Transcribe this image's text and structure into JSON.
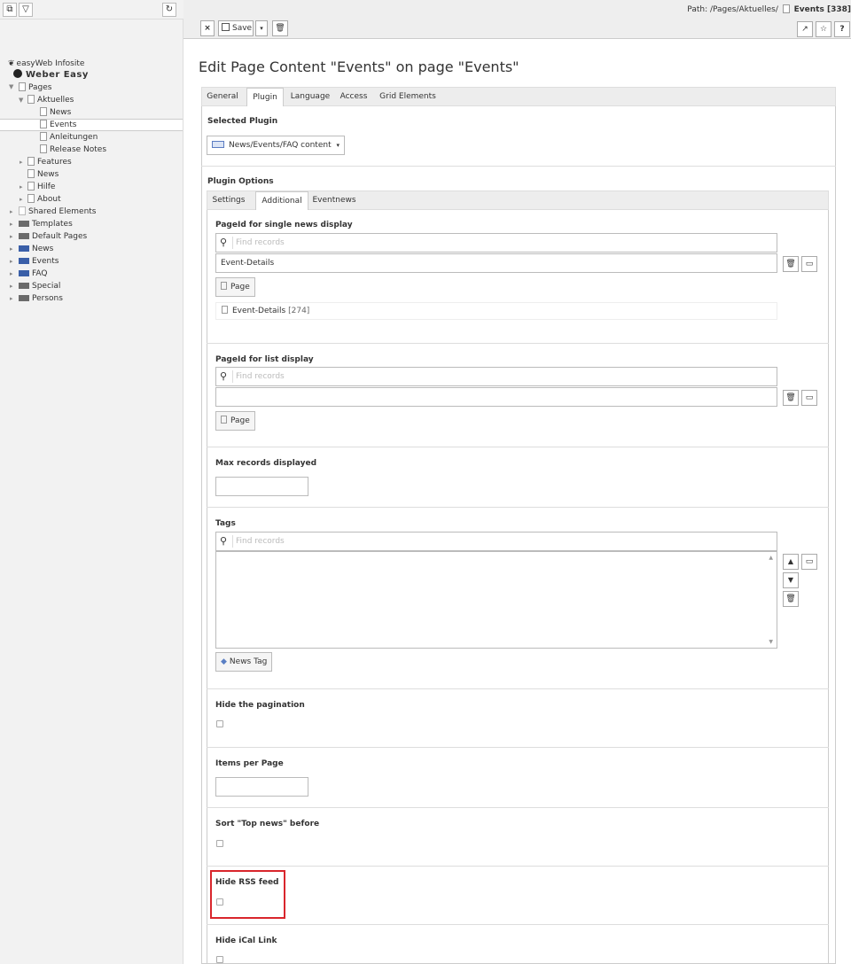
{
  "tree": {
    "toolbar": {
      "new_page_icon": "new-page-icon",
      "filter_icon": "filter-icon",
      "refresh_icon": "refresh-icon"
    },
    "site_name": "easyWeb Infosite",
    "root_title": "Weber Easy",
    "nodes": [
      {
        "label": "Pages"
      },
      {
        "label": "Aktuelles"
      },
      {
        "label": "News"
      },
      {
        "label": "Events"
      },
      {
        "label": "Anleitungen"
      },
      {
        "label": "Release Notes"
      },
      {
        "label": "Features"
      },
      {
        "label": "News"
      },
      {
        "label": "Hilfe"
      },
      {
        "label": "About"
      },
      {
        "label": "Shared Elements"
      },
      {
        "label": "Templates"
      },
      {
        "label": "Default Pages"
      },
      {
        "label": "News"
      },
      {
        "label": "Events"
      },
      {
        "label": "FAQ"
      },
      {
        "label": "Special"
      },
      {
        "label": "Persons"
      }
    ]
  },
  "toolbar": {
    "close_symbol": "×",
    "save_label": "Save",
    "path_prefix": "Path: /Pages/Aktuelles/",
    "path_current": "Events [338]",
    "help_symbol": "?"
  },
  "page_title": "Edit Page Content \"Events\" on page \"Events\"",
  "main_tabs": [
    "General",
    "Plugin",
    "Language",
    "Access",
    "Grid Elements"
  ],
  "selected_plugin": {
    "label": "Selected Plugin",
    "value": "News/Events/FAQ content"
  },
  "plugin_options": {
    "label": "Plugin Options",
    "tabs": [
      "Settings",
      "Additional",
      "Eventnews"
    ]
  },
  "fields": {
    "single_news": {
      "label": "PageId for single news display",
      "search_placeholder": "Find records",
      "value": "Event-Details",
      "add_label": "Page",
      "record": "Event-Details",
      "record_id": "[274]"
    },
    "list_display": {
      "label": "PageId for list display",
      "search_placeholder": "Find records",
      "value": "",
      "add_label": "Page"
    },
    "max_records": {
      "label": "Max records displayed",
      "value": ""
    },
    "tags": {
      "label": "Tags",
      "search_placeholder": "Find records",
      "add_label": "News Tag"
    },
    "hide_pagination": {
      "label": "Hide the pagination",
      "checked": false
    },
    "items_per_page": {
      "label": "Items per Page",
      "value": ""
    },
    "sort_top_news": {
      "label": "Sort \"Top news\" before",
      "checked": false
    },
    "hide_rss": {
      "label": "Hide RSS feed",
      "checked": false
    },
    "hide_ical": {
      "label": "Hide iCal Link",
      "checked": false
    }
  },
  "colors": {
    "highlight": "#d9262c",
    "folder_blue": "#3a5fa8"
  }
}
